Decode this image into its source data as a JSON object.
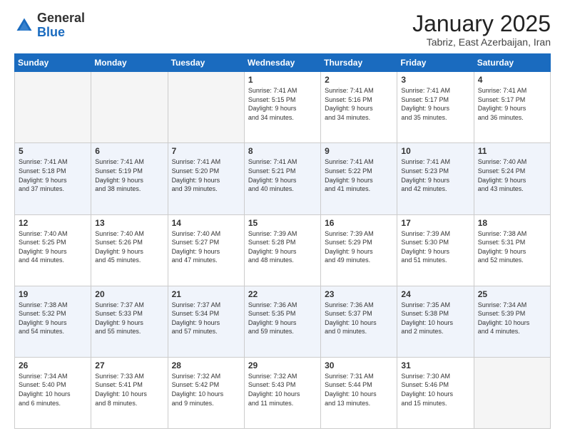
{
  "logo": {
    "general": "General",
    "blue": "Blue"
  },
  "header": {
    "month_year": "January 2025",
    "location": "Tabriz, East Azerbaijan, Iran"
  },
  "weekdays": [
    "Sunday",
    "Monday",
    "Tuesday",
    "Wednesday",
    "Thursday",
    "Friday",
    "Saturday"
  ],
  "weeks": [
    [
      {
        "day": "",
        "info": ""
      },
      {
        "day": "",
        "info": ""
      },
      {
        "day": "",
        "info": ""
      },
      {
        "day": "1",
        "info": "Sunrise: 7:41 AM\nSunset: 5:15 PM\nDaylight: 9 hours\nand 34 minutes."
      },
      {
        "day": "2",
        "info": "Sunrise: 7:41 AM\nSunset: 5:16 PM\nDaylight: 9 hours\nand 34 minutes."
      },
      {
        "day": "3",
        "info": "Sunrise: 7:41 AM\nSunset: 5:17 PM\nDaylight: 9 hours\nand 35 minutes."
      },
      {
        "day": "4",
        "info": "Sunrise: 7:41 AM\nSunset: 5:17 PM\nDaylight: 9 hours\nand 36 minutes."
      }
    ],
    [
      {
        "day": "5",
        "info": "Sunrise: 7:41 AM\nSunset: 5:18 PM\nDaylight: 9 hours\nand 37 minutes."
      },
      {
        "day": "6",
        "info": "Sunrise: 7:41 AM\nSunset: 5:19 PM\nDaylight: 9 hours\nand 38 minutes."
      },
      {
        "day": "7",
        "info": "Sunrise: 7:41 AM\nSunset: 5:20 PM\nDaylight: 9 hours\nand 39 minutes."
      },
      {
        "day": "8",
        "info": "Sunrise: 7:41 AM\nSunset: 5:21 PM\nDaylight: 9 hours\nand 40 minutes."
      },
      {
        "day": "9",
        "info": "Sunrise: 7:41 AM\nSunset: 5:22 PM\nDaylight: 9 hours\nand 41 minutes."
      },
      {
        "day": "10",
        "info": "Sunrise: 7:41 AM\nSunset: 5:23 PM\nDaylight: 9 hours\nand 42 minutes."
      },
      {
        "day": "11",
        "info": "Sunrise: 7:40 AM\nSunset: 5:24 PM\nDaylight: 9 hours\nand 43 minutes."
      }
    ],
    [
      {
        "day": "12",
        "info": "Sunrise: 7:40 AM\nSunset: 5:25 PM\nDaylight: 9 hours\nand 44 minutes."
      },
      {
        "day": "13",
        "info": "Sunrise: 7:40 AM\nSunset: 5:26 PM\nDaylight: 9 hours\nand 45 minutes."
      },
      {
        "day": "14",
        "info": "Sunrise: 7:40 AM\nSunset: 5:27 PM\nDaylight: 9 hours\nand 47 minutes."
      },
      {
        "day": "15",
        "info": "Sunrise: 7:39 AM\nSunset: 5:28 PM\nDaylight: 9 hours\nand 48 minutes."
      },
      {
        "day": "16",
        "info": "Sunrise: 7:39 AM\nSunset: 5:29 PM\nDaylight: 9 hours\nand 49 minutes."
      },
      {
        "day": "17",
        "info": "Sunrise: 7:39 AM\nSunset: 5:30 PM\nDaylight: 9 hours\nand 51 minutes."
      },
      {
        "day": "18",
        "info": "Sunrise: 7:38 AM\nSunset: 5:31 PM\nDaylight: 9 hours\nand 52 minutes."
      }
    ],
    [
      {
        "day": "19",
        "info": "Sunrise: 7:38 AM\nSunset: 5:32 PM\nDaylight: 9 hours\nand 54 minutes."
      },
      {
        "day": "20",
        "info": "Sunrise: 7:37 AM\nSunset: 5:33 PM\nDaylight: 9 hours\nand 55 minutes."
      },
      {
        "day": "21",
        "info": "Sunrise: 7:37 AM\nSunset: 5:34 PM\nDaylight: 9 hours\nand 57 minutes."
      },
      {
        "day": "22",
        "info": "Sunrise: 7:36 AM\nSunset: 5:35 PM\nDaylight: 9 hours\nand 59 minutes."
      },
      {
        "day": "23",
        "info": "Sunrise: 7:36 AM\nSunset: 5:37 PM\nDaylight: 10 hours\nand 0 minutes."
      },
      {
        "day": "24",
        "info": "Sunrise: 7:35 AM\nSunset: 5:38 PM\nDaylight: 10 hours\nand 2 minutes."
      },
      {
        "day": "25",
        "info": "Sunrise: 7:34 AM\nSunset: 5:39 PM\nDaylight: 10 hours\nand 4 minutes."
      }
    ],
    [
      {
        "day": "26",
        "info": "Sunrise: 7:34 AM\nSunset: 5:40 PM\nDaylight: 10 hours\nand 6 minutes."
      },
      {
        "day": "27",
        "info": "Sunrise: 7:33 AM\nSunset: 5:41 PM\nDaylight: 10 hours\nand 8 minutes."
      },
      {
        "day": "28",
        "info": "Sunrise: 7:32 AM\nSunset: 5:42 PM\nDaylight: 10 hours\nand 9 minutes."
      },
      {
        "day": "29",
        "info": "Sunrise: 7:32 AM\nSunset: 5:43 PM\nDaylight: 10 hours\nand 11 minutes."
      },
      {
        "day": "30",
        "info": "Sunrise: 7:31 AM\nSunset: 5:44 PM\nDaylight: 10 hours\nand 13 minutes."
      },
      {
        "day": "31",
        "info": "Sunrise: 7:30 AM\nSunset: 5:46 PM\nDaylight: 10 hours\nand 15 minutes."
      },
      {
        "day": "",
        "info": ""
      }
    ]
  ]
}
